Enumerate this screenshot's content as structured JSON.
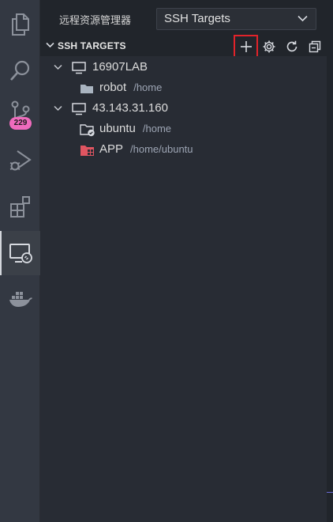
{
  "activity_bar": {
    "items": [
      {
        "name": "explorer",
        "icon": "files-icon"
      },
      {
        "name": "search",
        "icon": "search-icon"
      },
      {
        "name": "source-control",
        "icon": "source-control-icon",
        "badge": "229"
      },
      {
        "name": "run-debug",
        "icon": "run-debug-icon"
      },
      {
        "name": "extensions",
        "icon": "extensions-icon"
      },
      {
        "name": "remote-explorer",
        "icon": "remote-explorer-icon",
        "active": true
      },
      {
        "name": "docker",
        "icon": "docker-icon"
      }
    ]
  },
  "sidebar": {
    "title": "远程资源管理器",
    "target_select": {
      "value": "SSH Targets"
    },
    "section": {
      "title": "SSH TARGETS",
      "actions": [
        "add-icon",
        "gear-icon",
        "refresh-icon",
        "collapse-all-icon"
      ]
    },
    "tree": [
      {
        "type": "host",
        "label": "16907LAB",
        "expanded": true,
        "children": [
          {
            "label": "robot",
            "path": "/home",
            "icon": "folder-icon"
          }
        ]
      },
      {
        "type": "host",
        "label": "43.143.31.160",
        "expanded": true,
        "children": [
          {
            "label": "ubuntu",
            "path": "/home",
            "icon": "folder-connected-icon"
          },
          {
            "label": "APP",
            "path": "/home/ubuntu",
            "icon": "folder-red-icon"
          }
        ]
      }
    ]
  },
  "colors": {
    "activity_bar_bg": "#333842",
    "sidebar_bg": "#21252b",
    "tree_bg": "#282c34",
    "badge_bg": "#ef6bbd",
    "highlight_border": "#e2232a",
    "app_folder": "#e05561"
  }
}
